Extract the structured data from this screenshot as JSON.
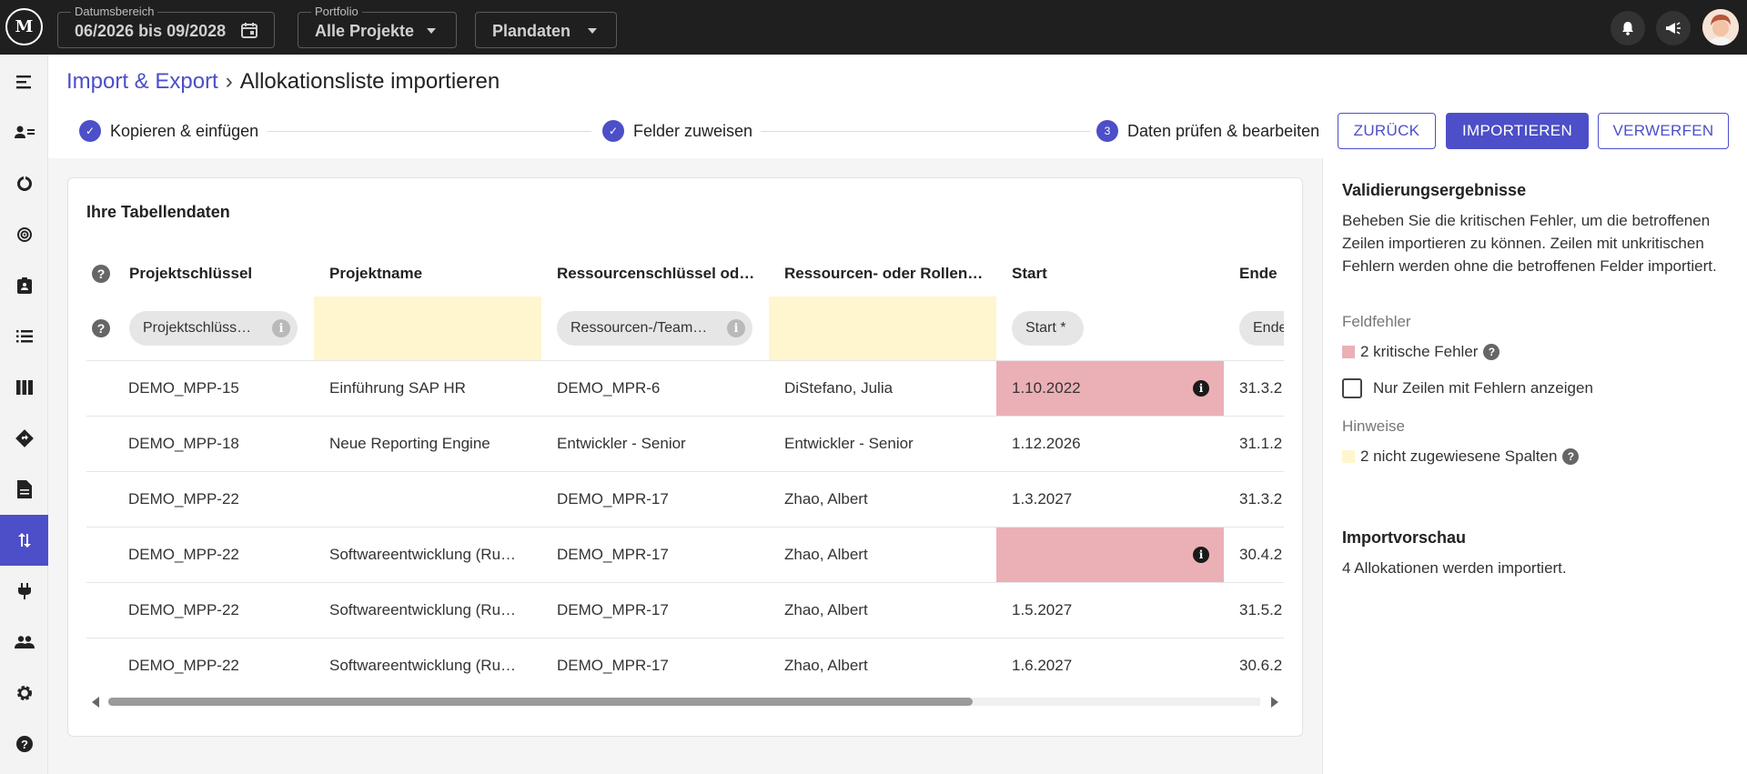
{
  "topbar": {
    "logo_text": "M",
    "date_label": "Datumsbereich",
    "date_value": "06/2026 bis 09/2028",
    "portfolio_label": "Portfolio",
    "portfolio_value": "Alle Projekte",
    "data_value": "Plandaten",
    "icons": [
      "bell-icon",
      "megaphone-icon",
      "avatar"
    ]
  },
  "sidebar": {
    "items": [
      "menu-icon",
      "resource-icon",
      "chart-icon",
      "target-icon",
      "clipboard-icon",
      "list-icon",
      "columns-icon",
      "roadmap-icon",
      "document-icon",
      "import-export-icon",
      "plug-icon",
      "people-icon",
      "settings-icon",
      "help-icon"
    ],
    "active_index": 9
  },
  "breadcrumb": {
    "parent": "Import & Export",
    "separator": "›",
    "current": "Allokationsliste importieren"
  },
  "steps": [
    {
      "label": "Kopieren & einfügen",
      "state": "done",
      "symbol": "✓"
    },
    {
      "label": "Felder zuweisen",
      "state": "done",
      "symbol": "✓"
    },
    {
      "label": "Daten prüfen & bearbeiten",
      "state": "active",
      "symbol": "3"
    }
  ],
  "buttons": {
    "back": "ZURÜCK",
    "import": "IMPORTIEREN",
    "discard": "VERWERFEN"
  },
  "table": {
    "title": "Ihre Tabellendaten",
    "help_symbol": "?",
    "columns": [
      "Projektschlüssel",
      "Projektname",
      "Ressourcenschlüssel od…",
      "Ressourcen- oder Rollen…",
      "Start",
      "Ende"
    ],
    "mapping": [
      "Projektschlüss…",
      "",
      "Ressourcen-/Team…",
      "",
      "Start *",
      "Ende"
    ],
    "info_symbol": "i",
    "rows": [
      [
        "DEMO_MPP-15",
        "Einführung SAP HR",
        "DEMO_MPR-6",
        "DiStefano, Julia",
        "1.10.2022",
        "31.3.2"
      ],
      [
        "DEMO_MPP-18",
        "Neue Reporting Engine",
        "Entwickler - Senior",
        "Entwickler - Senior",
        "1.12.2026",
        "31.1.2"
      ],
      [
        "DEMO_MPP-22",
        "",
        "DEMO_MPR-17",
        "Zhao, Albert",
        "1.3.2027",
        "31.3.2"
      ],
      [
        "DEMO_MPP-22",
        "Softwareentwicklung (Ru…",
        "DEMO_MPR-17",
        "Zhao, Albert",
        "",
        "30.4.2"
      ],
      [
        "DEMO_MPP-22",
        "Softwareentwicklung (Ru…",
        "DEMO_MPR-17",
        "Zhao, Albert",
        "1.5.2027",
        "31.5.2"
      ],
      [
        "DEMO_MPP-22",
        "Softwareentwicklung (Ru…",
        "DEMO_MPR-17",
        "Zhao, Albert",
        "1.6.2027",
        "30.6.2"
      ]
    ]
  },
  "validation": {
    "title": "Validierungsergebnisse",
    "description": "Beheben Sie die kritischen Fehler, um die betroffenen Zeilen importieren zu können. Zeilen mit unkritischen Fehlern werden ohne die betroffenen Felder importiert.",
    "field_errors_label": "Feldfehler",
    "critical_errors": "2 kritische Fehler",
    "only_errors_checkbox": "Nur Zeilen mit Fehlern anzeigen",
    "hints_label": "Hinweise",
    "unassigned_columns": "2 nicht zugewiesene Spalten"
  },
  "preview": {
    "title": "Importvorschau",
    "text": "4 Allokationen werden importiert."
  },
  "colors": {
    "accent": "#4c4fc8",
    "error": "#ebb0b6",
    "hint": "#fff5cf"
  }
}
